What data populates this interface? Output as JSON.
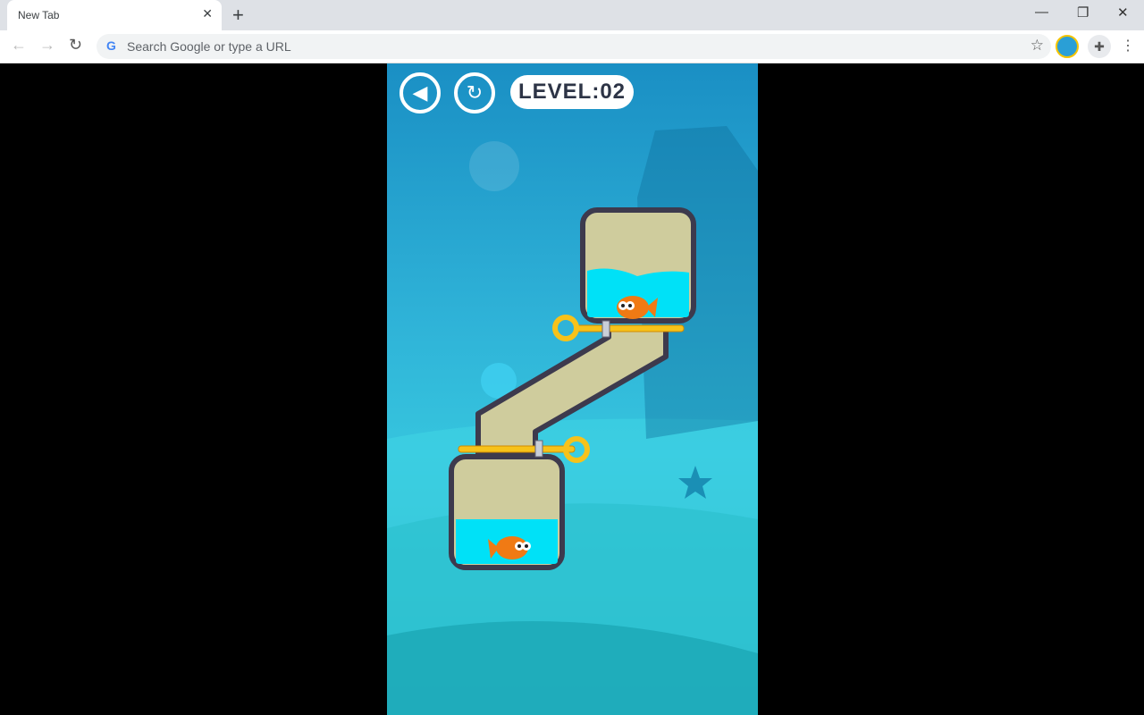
{
  "browser": {
    "tab_title": "New Tab",
    "omnibox_placeholder": "Search Google or type a URL"
  },
  "game": {
    "level_label": "LEVEL:02",
    "back_icon": "play-back-icon",
    "restart_icon": "restart-icon"
  },
  "colors": {
    "water": "#00e1f7",
    "sand": "#cfcc9d",
    "pipe": "#3d3a4d",
    "pin": "#f7c21a"
  }
}
